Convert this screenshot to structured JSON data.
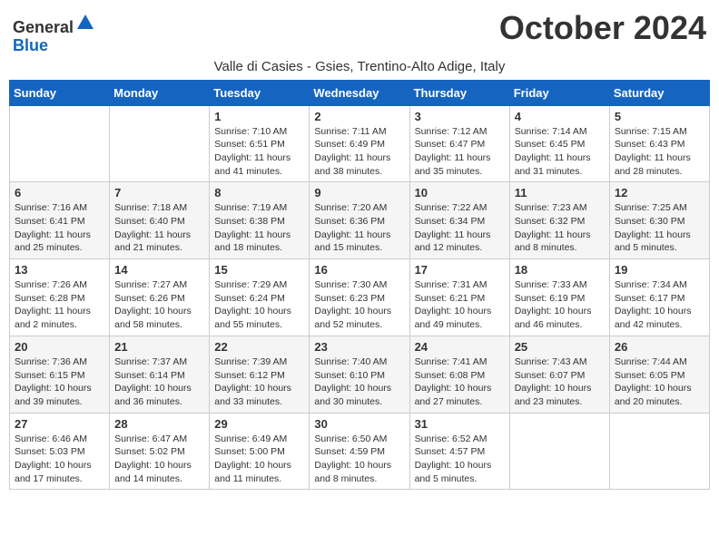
{
  "header": {
    "logo_general": "General",
    "logo_blue": "Blue",
    "month_title": "October 2024",
    "location": "Valle di Casies - Gsies, Trentino-Alto Adige, Italy"
  },
  "weekdays": [
    "Sunday",
    "Monday",
    "Tuesday",
    "Wednesday",
    "Thursday",
    "Friday",
    "Saturday"
  ],
  "weeks": [
    [
      {
        "day": "",
        "detail": ""
      },
      {
        "day": "",
        "detail": ""
      },
      {
        "day": "1",
        "detail": "Sunrise: 7:10 AM\nSunset: 6:51 PM\nDaylight: 11 hours and 41 minutes."
      },
      {
        "day": "2",
        "detail": "Sunrise: 7:11 AM\nSunset: 6:49 PM\nDaylight: 11 hours and 38 minutes."
      },
      {
        "day": "3",
        "detail": "Sunrise: 7:12 AM\nSunset: 6:47 PM\nDaylight: 11 hours and 35 minutes."
      },
      {
        "day": "4",
        "detail": "Sunrise: 7:14 AM\nSunset: 6:45 PM\nDaylight: 11 hours and 31 minutes."
      },
      {
        "day": "5",
        "detail": "Sunrise: 7:15 AM\nSunset: 6:43 PM\nDaylight: 11 hours and 28 minutes."
      }
    ],
    [
      {
        "day": "6",
        "detail": "Sunrise: 7:16 AM\nSunset: 6:41 PM\nDaylight: 11 hours and 25 minutes."
      },
      {
        "day": "7",
        "detail": "Sunrise: 7:18 AM\nSunset: 6:40 PM\nDaylight: 11 hours and 21 minutes."
      },
      {
        "day": "8",
        "detail": "Sunrise: 7:19 AM\nSunset: 6:38 PM\nDaylight: 11 hours and 18 minutes."
      },
      {
        "day": "9",
        "detail": "Sunrise: 7:20 AM\nSunset: 6:36 PM\nDaylight: 11 hours and 15 minutes."
      },
      {
        "day": "10",
        "detail": "Sunrise: 7:22 AM\nSunset: 6:34 PM\nDaylight: 11 hours and 12 minutes."
      },
      {
        "day": "11",
        "detail": "Sunrise: 7:23 AM\nSunset: 6:32 PM\nDaylight: 11 hours and 8 minutes."
      },
      {
        "day": "12",
        "detail": "Sunrise: 7:25 AM\nSunset: 6:30 PM\nDaylight: 11 hours and 5 minutes."
      }
    ],
    [
      {
        "day": "13",
        "detail": "Sunrise: 7:26 AM\nSunset: 6:28 PM\nDaylight: 11 hours and 2 minutes."
      },
      {
        "day": "14",
        "detail": "Sunrise: 7:27 AM\nSunset: 6:26 PM\nDaylight: 10 hours and 58 minutes."
      },
      {
        "day": "15",
        "detail": "Sunrise: 7:29 AM\nSunset: 6:24 PM\nDaylight: 10 hours and 55 minutes."
      },
      {
        "day": "16",
        "detail": "Sunrise: 7:30 AM\nSunset: 6:23 PM\nDaylight: 10 hours and 52 minutes."
      },
      {
        "day": "17",
        "detail": "Sunrise: 7:31 AM\nSunset: 6:21 PM\nDaylight: 10 hours and 49 minutes."
      },
      {
        "day": "18",
        "detail": "Sunrise: 7:33 AM\nSunset: 6:19 PM\nDaylight: 10 hours and 46 minutes."
      },
      {
        "day": "19",
        "detail": "Sunrise: 7:34 AM\nSunset: 6:17 PM\nDaylight: 10 hours and 42 minutes."
      }
    ],
    [
      {
        "day": "20",
        "detail": "Sunrise: 7:36 AM\nSunset: 6:15 PM\nDaylight: 10 hours and 39 minutes."
      },
      {
        "day": "21",
        "detail": "Sunrise: 7:37 AM\nSunset: 6:14 PM\nDaylight: 10 hours and 36 minutes."
      },
      {
        "day": "22",
        "detail": "Sunrise: 7:39 AM\nSunset: 6:12 PM\nDaylight: 10 hours and 33 minutes."
      },
      {
        "day": "23",
        "detail": "Sunrise: 7:40 AM\nSunset: 6:10 PM\nDaylight: 10 hours and 30 minutes."
      },
      {
        "day": "24",
        "detail": "Sunrise: 7:41 AM\nSunset: 6:08 PM\nDaylight: 10 hours and 27 minutes."
      },
      {
        "day": "25",
        "detail": "Sunrise: 7:43 AM\nSunset: 6:07 PM\nDaylight: 10 hours and 23 minutes."
      },
      {
        "day": "26",
        "detail": "Sunrise: 7:44 AM\nSunset: 6:05 PM\nDaylight: 10 hours and 20 minutes."
      }
    ],
    [
      {
        "day": "27",
        "detail": "Sunrise: 6:46 AM\nSunset: 5:03 PM\nDaylight: 10 hours and 17 minutes."
      },
      {
        "day": "28",
        "detail": "Sunrise: 6:47 AM\nSunset: 5:02 PM\nDaylight: 10 hours and 14 minutes."
      },
      {
        "day": "29",
        "detail": "Sunrise: 6:49 AM\nSunset: 5:00 PM\nDaylight: 10 hours and 11 minutes."
      },
      {
        "day": "30",
        "detail": "Sunrise: 6:50 AM\nSunset: 4:59 PM\nDaylight: 10 hours and 8 minutes."
      },
      {
        "day": "31",
        "detail": "Sunrise: 6:52 AM\nSunset: 4:57 PM\nDaylight: 10 hours and 5 minutes."
      },
      {
        "day": "",
        "detail": ""
      },
      {
        "day": "",
        "detail": ""
      }
    ]
  ]
}
